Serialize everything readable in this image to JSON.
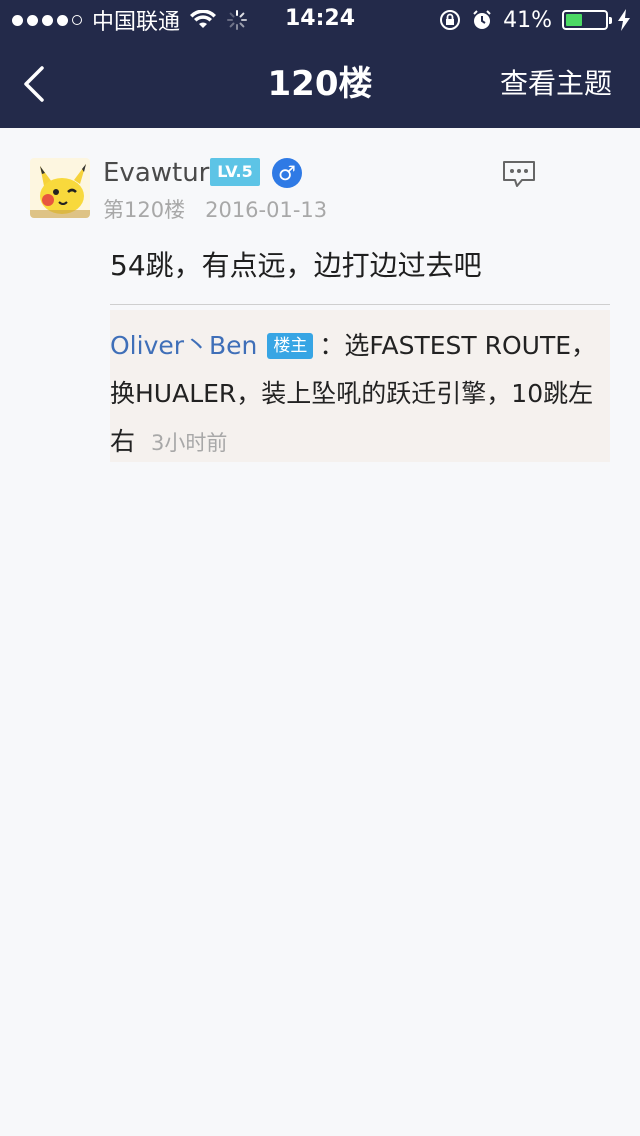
{
  "status_bar": {
    "carrier": "中国联通",
    "time": "14:24",
    "battery": "41%",
    "battery_level": 0.41
  },
  "nav": {
    "title": "120楼",
    "right_label": "查看主题"
  },
  "post": {
    "username": "Evawtur",
    "level_badge": "LV.5",
    "gender_symbol": "♂",
    "floor": "第120楼",
    "date": "2016-01-13",
    "content": "54跳，有点远，边打边过去吧",
    "sub_reply": {
      "author": "Oliver丶Ben",
      "owner_badge": "楼主",
      "text": "：选FASTEST ROUTE，换HUALER，装上坠吼的跃迁引擎，10跳左右",
      "time": "3小时前"
    }
  }
}
